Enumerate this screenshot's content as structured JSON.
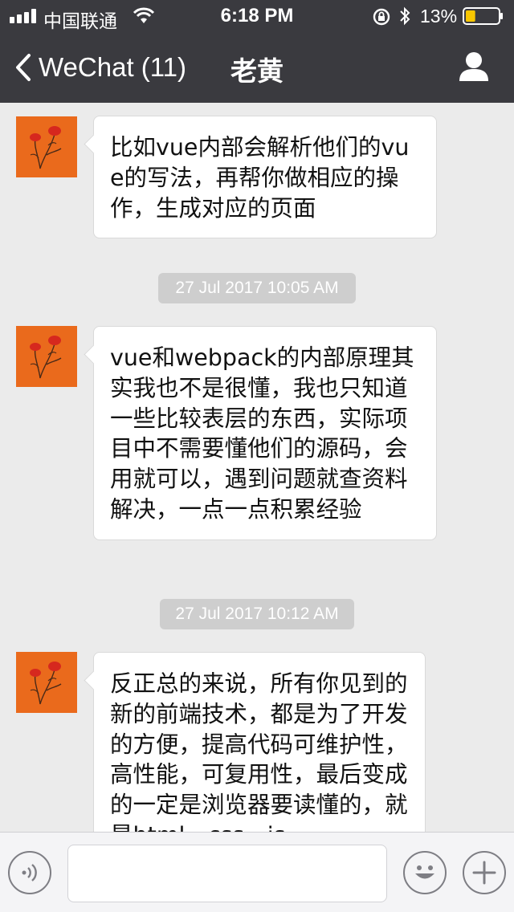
{
  "status_bar": {
    "carrier": "中国联通",
    "time": "6:18 PM",
    "battery_percent": "13%",
    "battery_level": 0.13,
    "icons": [
      "signal-icon",
      "wifi-icon",
      "orientation-lock-icon",
      "bluetooth-icon",
      "battery-icon"
    ]
  },
  "nav": {
    "back_label": "WeChat (11)",
    "title": "老黄",
    "icons": [
      "chevron-left-icon",
      "profile-icon"
    ]
  },
  "messages": [
    {
      "type": "received",
      "text": "比如vue内部会解析他们的vue的写法，再帮你做相应的操作，生成对应的页面"
    },
    {
      "type": "timestamp",
      "text": "27 Jul 2017 10:05 AM"
    },
    {
      "type": "received",
      "text": "vue和webpack的内部原理其实我也不是很懂，我也只知道一些比较表层的东西，实际项目中不需要懂他们的源码，会用就可以，遇到问题就查资料解决，一点一点积累经验"
    },
    {
      "type": "timestamp",
      "text": "27 Jul 2017 10:12 AM"
    },
    {
      "type": "received",
      "text": "反正总的来说，所有你见到的新的前端技术，都是为了开发的方便，提高代码可维护性，高性能，可复用性，最后变成的一定是浏览器要读懂的，就是html，css，js"
    }
  ],
  "input_bar": {
    "text_value": "",
    "icons": [
      "voice-icon",
      "emoji-icon",
      "plus-icon"
    ]
  },
  "colors": {
    "bar_background": "#3a3a3f",
    "chat_background": "#ebebeb",
    "avatar_orange": "#ea6a1c",
    "timestamp_background": "#cecece"
  }
}
